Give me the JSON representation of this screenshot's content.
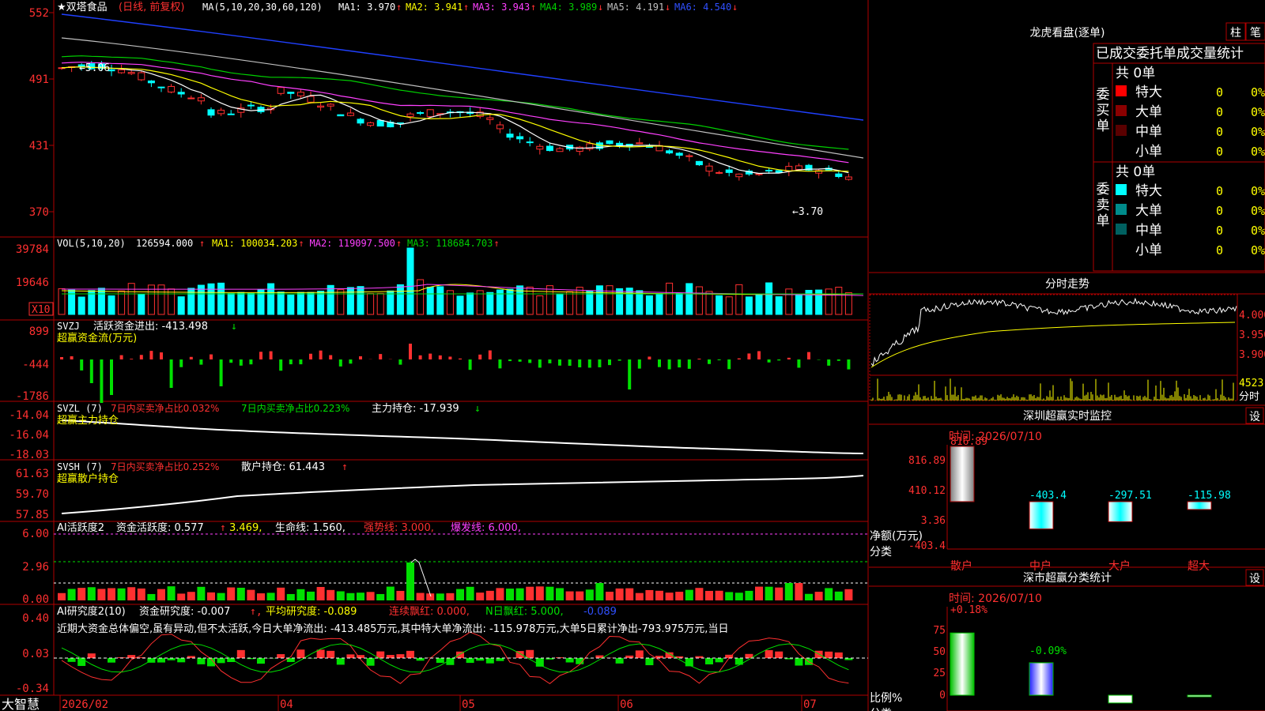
{
  "colors": {
    "border": "#b00000",
    "up": "#ff3030",
    "down": "#00ffff",
    "white": "#ffffff",
    "yellow": "#ffff00",
    "magenta": "#ff40ff",
    "green": "#00d000",
    "blue": "#3050ff",
    "gray": "#c0c0c0",
    "red": "#ff3030",
    "flowGreen": "#00e000"
  },
  "header": {
    "stock_name": "★双塔食品",
    "period": "(日线, 前复权)",
    "ma_list": "MA(5,10,20,30,60,120)",
    "ma": [
      {
        "label": "MA1: 3.970",
        "arrow": "↑",
        "color": "#ffffff"
      },
      {
        "label": "MA2: 3.941",
        "arrow": "↑",
        "color": "#ffff00"
      },
      {
        "label": "MA3: 3.943",
        "arrow": "↑",
        "color": "#ff40ff"
      },
      {
        "label": "MA4: 3.989",
        "arrow": "↓",
        "color": "#00d000"
      },
      {
        "label": "MA5: 4.191",
        "arrow": "↓",
        "color": "#c0c0c0"
      },
      {
        "label": "MA6: 4.540",
        "arrow": "↓",
        "color": "#3050ff"
      }
    ]
  },
  "price_axis": [
    "552",
    "491",
    "431",
    "370"
  ],
  "annotations": {
    "high": "←5.06",
    "low": "←3.70"
  },
  "vol": {
    "title": "VOL(5,10,20)",
    "value": "126594.000",
    "ma": [
      {
        "label": "MA1: 100034.203",
        "arrow": "↑",
        "color": "#ffff00"
      },
      {
        "label": "MA2: 119097.500",
        "arrow": "↑",
        "color": "#ff40ff"
      },
      {
        "label": "MA3: 118684.703",
        "arrow": "↑",
        "color": "#00d000"
      }
    ],
    "axis": [
      "39784",
      "19646"
    ],
    "unit": "X10"
  },
  "svzj": {
    "title": "SVZJ",
    "text": "活跃资金进出: -413.498",
    "arrow": "↓",
    "sub": "超赢资金流(万元)",
    "axis": [
      "899",
      "-444",
      "-1786"
    ]
  },
  "svzl": {
    "title": "SVZL (7)",
    "t1": "7日内买卖净占比0.032%",
    "t2": "7日内买卖净占比0.223%",
    "t3": "主力持仓: -17.939",
    "arrow": "↓",
    "sub": "超赢主力持仓",
    "axis": [
      "-14.04",
      "-16.04",
      "-18.03"
    ]
  },
  "svsh": {
    "title": "SVSH (7)",
    "t1": "7日内买卖净占比0.252%",
    "t2": "散户持仓: 61.443",
    "arrow": "↑",
    "sub": "超赢散户持仓",
    "axis": [
      "61.63",
      "59.70",
      "57.85"
    ]
  },
  "ai_active": {
    "title": "AI活跃度2",
    "t1": "资金活跃度: 0.577",
    "t2": "3.469,",
    "t3": "生命线: 1.560,",
    "t4": "强势线: 3.000,",
    "t5": "爆发线: 6.000,",
    "axis": [
      "6.00",
      "2.96",
      "0.00"
    ]
  },
  "ai_research": {
    "title": "AI研究度2(10)",
    "t1": "资金研究度: -0.007",
    "t2": "平均研究度: -0.089",
    "t3": "连续飘红: 0.000,",
    "t4": "N日飘红: 5.000,",
    "t5": "-0.089",
    "comment": "近期大资金总体偏空,虽有异动,但不太活跃,今日大单净流出: -413.485万元,其中特大单净流出: -115.978万元,大单5日累计净出-793.975万元,当日",
    "axis": [
      "0.40",
      "0.03",
      "-0.34"
    ]
  },
  "xaxis": {
    "brand": "大智慧",
    "labels": [
      "2026/02",
      "04",
      "05",
      "06",
      "07"
    ]
  },
  "lhb": {
    "title": "龙虎看盘(逐单)",
    "btn1": "柱",
    "btn2": "笔",
    "header": "已成交委托单成交量统计",
    "buy_label": "委买单",
    "sell_label": "委卖单",
    "buy_total": "共 0单",
    "sell_total": "共 0单",
    "buy_rows": [
      {
        "name": "特大",
        "count": "0",
        "pct": "0%",
        "color": "#ff0000"
      },
      {
        "name": "大单",
        "count": "0",
        "pct": "0%",
        "color": "#8b0000"
      },
      {
        "name": "中单",
        "count": "0",
        "pct": "0%",
        "color": "#5a0000"
      },
      {
        "name": "小单",
        "count": "0",
        "pct": "0%",
        "color": "#000000"
      }
    ],
    "sell_rows": [
      {
        "name": "特大",
        "count": "0",
        "pct": "0%",
        "color": "#00ffff"
      },
      {
        "name": "大单",
        "count": "0",
        "pct": "0%",
        "color": "#008b8b"
      },
      {
        "name": "中单",
        "count": "0",
        "pct": "0%",
        "color": "#006060"
      },
      {
        "name": "小单",
        "count": "0",
        "pct": "0%",
        "color": "#000000"
      }
    ]
  },
  "intraday": {
    "title": "分时走势",
    "axis": [
      "4.000",
      "3.950",
      "3.900"
    ],
    "vol_value": "4523",
    "vol_label": "分时"
  },
  "sz_monitor": {
    "title": "深圳超赢实时监控",
    "btn": "设",
    "time": "时间: 2026/07/10",
    "axis": [
      "816.89",
      "410.12",
      "3.36",
      "-403.4"
    ],
    "ylabel": "净额(万元)",
    "xlabel": "分类",
    "bars": [
      {
        "name": "散户",
        "value": 816.89,
        "label": "816.89"
      },
      {
        "name": "中户",
        "value": -403.4,
        "label": "-403.4"
      },
      {
        "name": "大户",
        "value": -297.51,
        "label": "-297.51"
      },
      {
        "name": "超大",
        "value": -115.98,
        "label": "-115.98"
      }
    ]
  },
  "sz_stats": {
    "title": "深市超赢分类统计",
    "btn": "设",
    "time": "时间: 2026/07/10",
    "axis": [
      "75",
      "50",
      "25",
      "0"
    ],
    "ylabel": "比例%",
    "xlabel": "分类",
    "top_labels": [
      "+0.18%",
      "-0.09%"
    ],
    "bars": [
      {
        "name": "散户",
        "value": 72.94,
        "label": "72.94"
      },
      {
        "name": "中户",
        "value": 38.0,
        "label": "38.00"
      },
      {
        "name": "大户",
        "value": -9.12,
        "label": "-9.12"
      },
      {
        "name": "超大",
        "value": -1.82,
        "label": "-1.82"
      }
    ]
  }
}
